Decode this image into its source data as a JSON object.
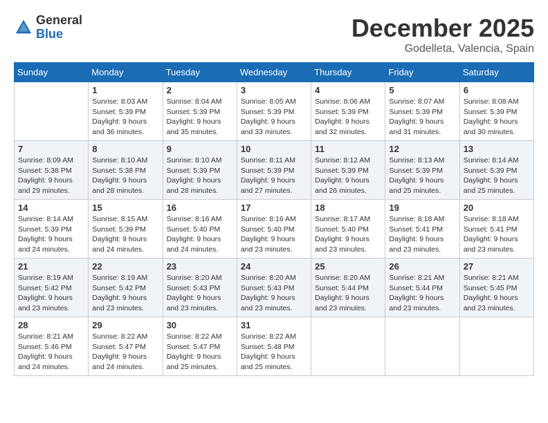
{
  "header": {
    "logo_general": "General",
    "logo_blue": "Blue",
    "month_title": "December 2025",
    "subtitle": "Godelleta, Valencia, Spain"
  },
  "days_of_week": [
    "Sunday",
    "Monday",
    "Tuesday",
    "Wednesday",
    "Thursday",
    "Friday",
    "Saturday"
  ],
  "weeks": [
    [
      {
        "day": "",
        "info": ""
      },
      {
        "day": "1",
        "info": "Sunrise: 8:03 AM\nSunset: 5:39 PM\nDaylight: 9 hours\nand 36 minutes."
      },
      {
        "day": "2",
        "info": "Sunrise: 8:04 AM\nSunset: 5:39 PM\nDaylight: 9 hours\nand 35 minutes."
      },
      {
        "day": "3",
        "info": "Sunrise: 8:05 AM\nSunset: 5:39 PM\nDaylight: 9 hours\nand 33 minutes."
      },
      {
        "day": "4",
        "info": "Sunrise: 8:06 AM\nSunset: 5:39 PM\nDaylight: 9 hours\nand 32 minutes."
      },
      {
        "day": "5",
        "info": "Sunrise: 8:07 AM\nSunset: 5:39 PM\nDaylight: 9 hours\nand 31 minutes."
      },
      {
        "day": "6",
        "info": "Sunrise: 8:08 AM\nSunset: 5:39 PM\nDaylight: 9 hours\nand 30 minutes."
      }
    ],
    [
      {
        "day": "7",
        "info": "Sunrise: 8:09 AM\nSunset: 5:38 PM\nDaylight: 9 hours\nand 29 minutes."
      },
      {
        "day": "8",
        "info": "Sunrise: 8:10 AM\nSunset: 5:38 PM\nDaylight: 9 hours\nand 28 minutes."
      },
      {
        "day": "9",
        "info": "Sunrise: 8:10 AM\nSunset: 5:39 PM\nDaylight: 9 hours\nand 28 minutes."
      },
      {
        "day": "10",
        "info": "Sunrise: 8:11 AM\nSunset: 5:39 PM\nDaylight: 9 hours\nand 27 minutes."
      },
      {
        "day": "11",
        "info": "Sunrise: 8:12 AM\nSunset: 5:39 PM\nDaylight: 9 hours\nand 26 minutes."
      },
      {
        "day": "12",
        "info": "Sunrise: 8:13 AM\nSunset: 5:39 PM\nDaylight: 9 hours\nand 25 minutes."
      },
      {
        "day": "13",
        "info": "Sunrise: 8:14 AM\nSunset: 5:39 PM\nDaylight: 9 hours\nand 25 minutes."
      }
    ],
    [
      {
        "day": "14",
        "info": "Sunrise: 8:14 AM\nSunset: 5:39 PM\nDaylight: 9 hours\nand 24 minutes."
      },
      {
        "day": "15",
        "info": "Sunrise: 8:15 AM\nSunset: 5:39 PM\nDaylight: 9 hours\nand 24 minutes."
      },
      {
        "day": "16",
        "info": "Sunrise: 8:16 AM\nSunset: 5:40 PM\nDaylight: 9 hours\nand 24 minutes."
      },
      {
        "day": "17",
        "info": "Sunrise: 8:16 AM\nSunset: 5:40 PM\nDaylight: 9 hours\nand 23 minutes."
      },
      {
        "day": "18",
        "info": "Sunrise: 8:17 AM\nSunset: 5:40 PM\nDaylight: 9 hours\nand 23 minutes."
      },
      {
        "day": "19",
        "info": "Sunrise: 8:18 AM\nSunset: 5:41 PM\nDaylight: 9 hours\nand 23 minutes."
      },
      {
        "day": "20",
        "info": "Sunrise: 8:18 AM\nSunset: 5:41 PM\nDaylight: 9 hours\nand 23 minutes."
      }
    ],
    [
      {
        "day": "21",
        "info": "Sunrise: 8:19 AM\nSunset: 5:42 PM\nDaylight: 9 hours\nand 23 minutes."
      },
      {
        "day": "22",
        "info": "Sunrise: 8:19 AM\nSunset: 5:42 PM\nDaylight: 9 hours\nand 23 minutes."
      },
      {
        "day": "23",
        "info": "Sunrise: 8:20 AM\nSunset: 5:43 PM\nDaylight: 9 hours\nand 23 minutes."
      },
      {
        "day": "24",
        "info": "Sunrise: 8:20 AM\nSunset: 5:43 PM\nDaylight: 9 hours\nand 23 minutes."
      },
      {
        "day": "25",
        "info": "Sunrise: 8:20 AM\nSunset: 5:44 PM\nDaylight: 9 hours\nand 23 minutes."
      },
      {
        "day": "26",
        "info": "Sunrise: 8:21 AM\nSunset: 5:44 PM\nDaylight: 9 hours\nand 23 minutes."
      },
      {
        "day": "27",
        "info": "Sunrise: 8:21 AM\nSunset: 5:45 PM\nDaylight: 9 hours\nand 23 minutes."
      }
    ],
    [
      {
        "day": "28",
        "info": "Sunrise: 8:21 AM\nSunset: 5:46 PM\nDaylight: 9 hours\nand 24 minutes."
      },
      {
        "day": "29",
        "info": "Sunrise: 8:22 AM\nSunset: 5:47 PM\nDaylight: 9 hours\nand 24 minutes."
      },
      {
        "day": "30",
        "info": "Sunrise: 8:22 AM\nSunset: 5:47 PM\nDaylight: 9 hours\nand 25 minutes."
      },
      {
        "day": "31",
        "info": "Sunrise: 8:22 AM\nSunset: 5:48 PM\nDaylight: 9 hours\nand 25 minutes."
      },
      {
        "day": "",
        "info": ""
      },
      {
        "day": "",
        "info": ""
      },
      {
        "day": "",
        "info": ""
      }
    ]
  ]
}
